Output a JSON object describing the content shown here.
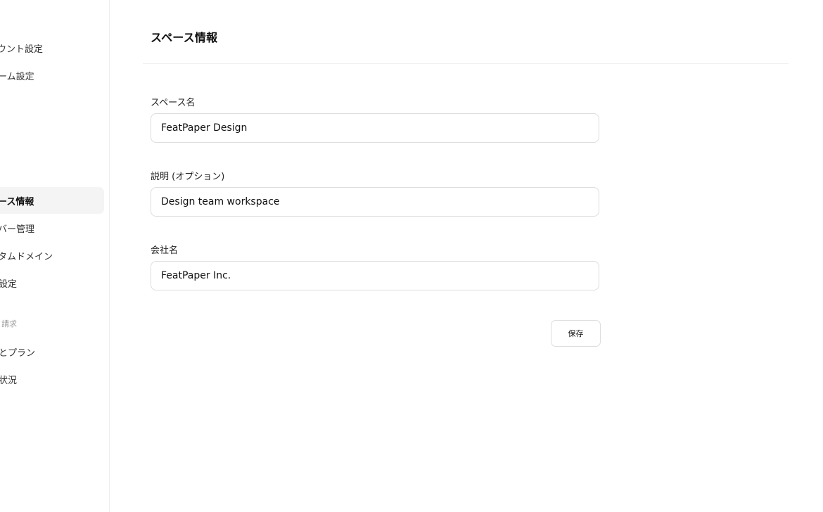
{
  "sidebar": {
    "items": [
      {
        "label": "ウント設定",
        "active": false
      },
      {
        "label": "ーム設定",
        "active": false
      },
      {
        "label": "ース情報",
        "active": true
      },
      {
        "label": "バー管理",
        "active": false
      },
      {
        "label": "タムドメイン",
        "active": false
      },
      {
        "label": "設定",
        "active": false
      },
      {
        "label": "とプラン",
        "active": false
      },
      {
        "label": "状況",
        "active": false
      }
    ],
    "section_billing": "請求"
  },
  "main": {
    "title": "スペース情報",
    "fields": [
      {
        "label": "スペース名",
        "value": "FeatPaper Design"
      },
      {
        "label": "説明 (オプション)",
        "value": "Design team workspace"
      },
      {
        "label": "会社名",
        "value": "FeatPaper Inc."
      }
    ],
    "save_label": "保存"
  }
}
